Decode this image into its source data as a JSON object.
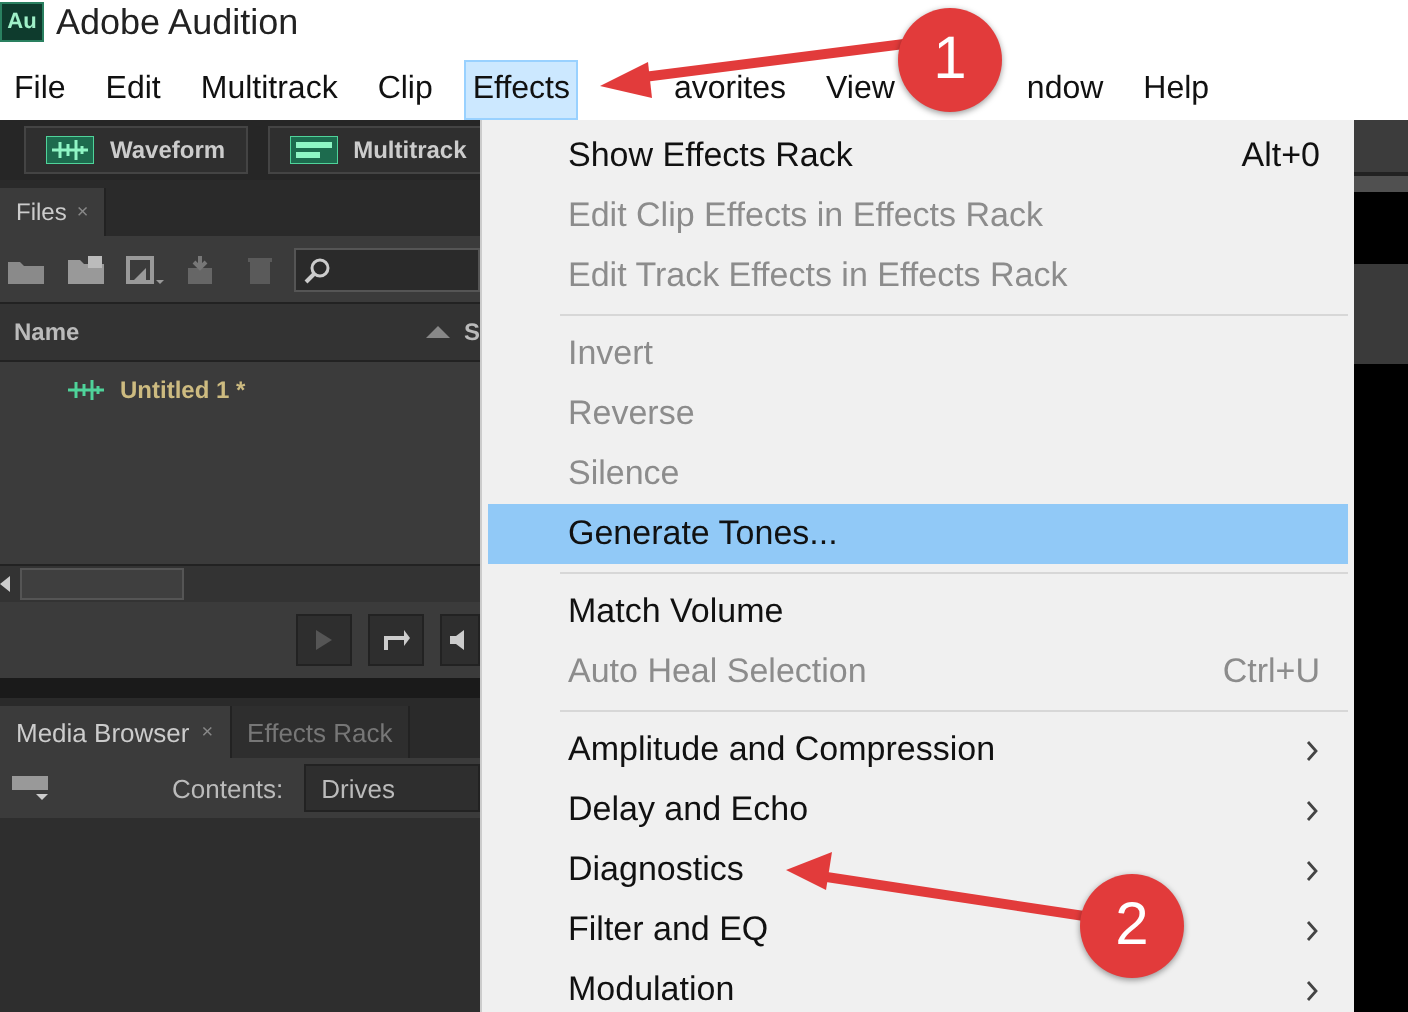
{
  "window": {
    "title": "Adobe Audition",
    "app_icon_text": "Au"
  },
  "menubar": [
    {
      "label": "File",
      "selected": false
    },
    {
      "label": "Edit",
      "selected": false
    },
    {
      "label": "Multitrack",
      "selected": false
    },
    {
      "label": "Clip",
      "selected": false
    },
    {
      "label": "Effects",
      "selected": true
    },
    {
      "label": "avorites",
      "selected": false
    },
    {
      "label": "View",
      "selected": false
    },
    {
      "label": "ndow",
      "selected": false
    },
    {
      "label": "Help",
      "selected": false
    }
  ],
  "workspace_buttons": [
    {
      "label": "Waveform",
      "kind": "waveform"
    },
    {
      "label": "Multitrack",
      "kind": "multitrack"
    }
  ],
  "files_panel": {
    "tab": "Files",
    "tab_close": "×",
    "columns": [
      "Name",
      "S"
    ],
    "files": [
      {
        "name": "Untitled 1 *"
      }
    ]
  },
  "bottom_panel": {
    "tabs": [
      {
        "label": "Media Browser",
        "selected": true,
        "close": "×"
      },
      {
        "label": "Effects Rack",
        "selected": false
      }
    ],
    "contents_label": "Contents:",
    "contents_value": "Drives"
  },
  "effects_menu": [
    {
      "kind": "item",
      "label": "Show Effects Rack",
      "shortcut": "Alt+0",
      "disabled": false,
      "selected": false
    },
    {
      "kind": "item",
      "label": "Edit Clip Effects in Effects Rack",
      "disabled": true,
      "selected": false
    },
    {
      "kind": "item",
      "label": "Edit Track Effects in Effects Rack",
      "disabled": true,
      "selected": false
    },
    {
      "kind": "separator"
    },
    {
      "kind": "item",
      "label": "Invert",
      "disabled": true,
      "selected": false
    },
    {
      "kind": "item",
      "label": "Reverse",
      "disabled": true,
      "selected": false
    },
    {
      "kind": "item",
      "label": "Silence",
      "disabled": true,
      "selected": false
    },
    {
      "kind": "item",
      "label": "Generate Tones...",
      "disabled": false,
      "selected": true
    },
    {
      "kind": "separator"
    },
    {
      "kind": "item",
      "label": "Match Volume",
      "disabled": false,
      "selected": false
    },
    {
      "kind": "item",
      "label": "Auto Heal Selection",
      "shortcut": "Ctrl+U",
      "disabled": true,
      "selected": false
    },
    {
      "kind": "separator"
    },
    {
      "kind": "submenu",
      "label": "Amplitude and Compression",
      "disabled": false,
      "selected": false
    },
    {
      "kind": "submenu",
      "label": "Delay and Echo",
      "disabled": false,
      "selected": false
    },
    {
      "kind": "submenu",
      "label": "Diagnostics",
      "disabled": false,
      "selected": false
    },
    {
      "kind": "submenu",
      "label": "Filter and EQ",
      "disabled": false,
      "selected": false
    },
    {
      "kind": "submenu",
      "label": "Modulation",
      "disabled": false,
      "selected": false
    }
  ],
  "annotations": [
    {
      "label": "1"
    },
    {
      "label": "2"
    }
  ]
}
